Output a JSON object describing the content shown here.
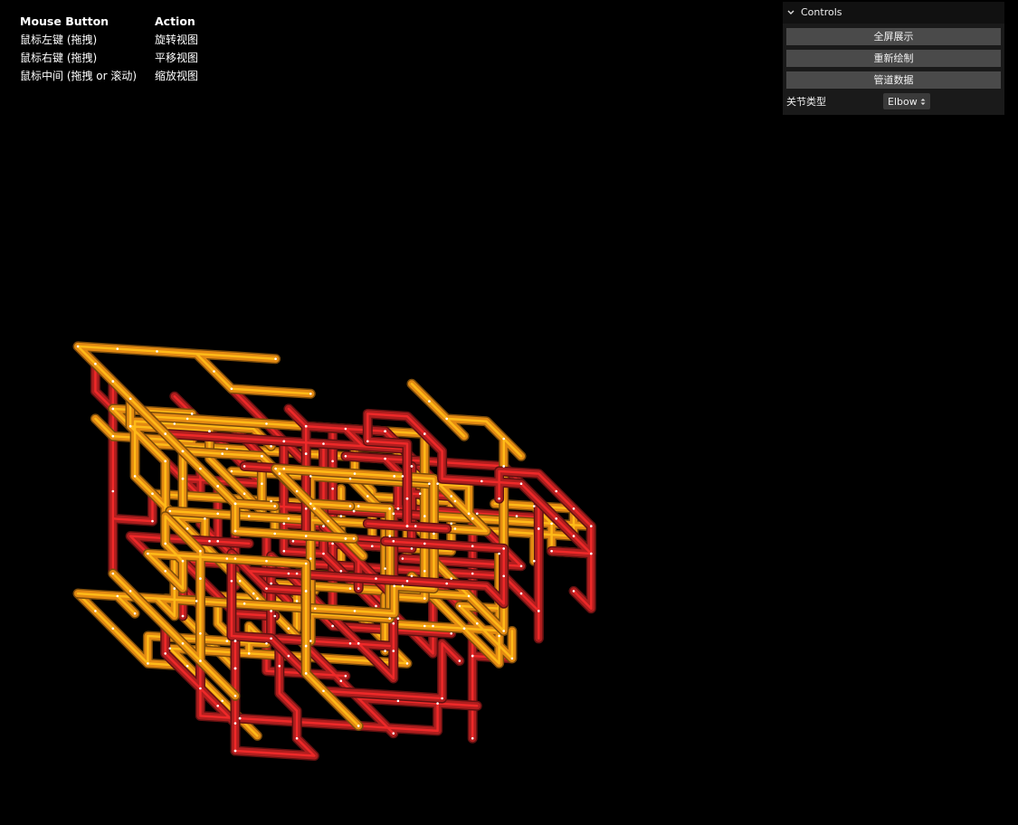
{
  "help": {
    "header_button": "Mouse Button",
    "header_action": "Action",
    "rows": [
      {
        "button": "鼠标左键 (拖拽)",
        "action": "旋转视图"
      },
      {
        "button": "鼠标右键 (拖拽)",
        "action": "平移视图"
      },
      {
        "button": "鼠标中间 (拖拽 or 滚动)",
        "action": "缩放视图"
      }
    ]
  },
  "controls": {
    "title": "Controls",
    "buttons": [
      "全屏展示",
      "重新绘制",
      "管道数据"
    ],
    "joint_label": "关节类型",
    "joint_value": "Elbow"
  },
  "scene": {
    "background": "#000000",
    "pipe_colors": [
      "#b01e1e",
      "#e38a12"
    ],
    "joint_dot_color": "#ffffff"
  }
}
